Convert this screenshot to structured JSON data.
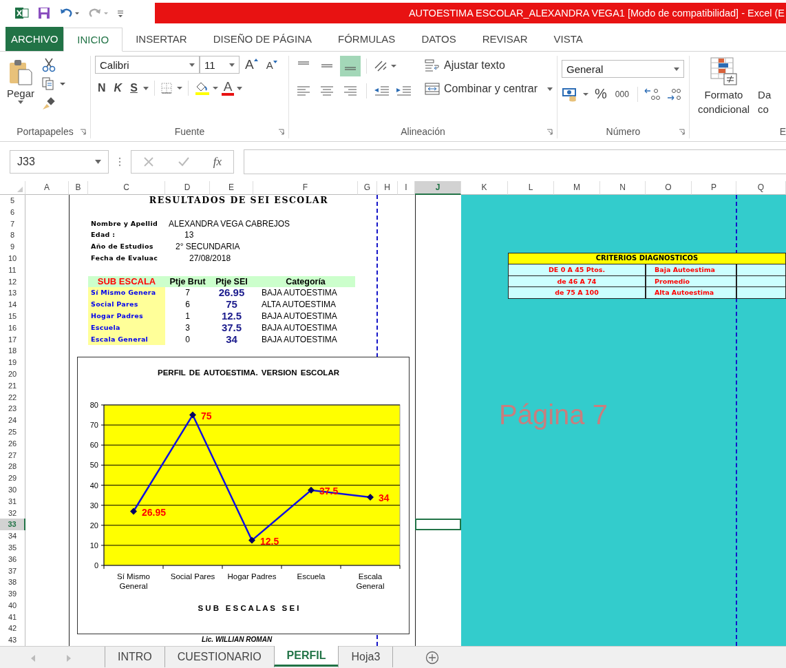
{
  "window": {
    "title": "AUTOESTIMA ESCOLAR_ALEXANDRA VEGA1  [Modo de compatibilidad] -  Excel (E"
  },
  "ribbon_tabs": [
    {
      "label": "ARCHIVO",
      "kind": "file",
      "selected": false
    },
    {
      "label": "INICIO",
      "kind": "tab",
      "selected": true
    },
    {
      "label": "INSERTAR",
      "kind": "tab",
      "selected": false
    },
    {
      "label": "DISEÑO DE PÁGINA",
      "kind": "tab",
      "selected": false
    },
    {
      "label": "FÓRMULAS",
      "kind": "tab",
      "selected": false
    },
    {
      "label": "DATOS",
      "kind": "tab",
      "selected": false
    },
    {
      "label": "REVISAR",
      "kind": "tab",
      "selected": false
    },
    {
      "label": "VISTA",
      "kind": "tab",
      "selected": false
    }
  ],
  "ribbon": {
    "clipboard": {
      "paste": "Pegar",
      "label": "Portapapeles"
    },
    "font": {
      "family": "Calibri",
      "size": "11",
      "grow": "A",
      "shrink": "A",
      "bold": "N",
      "italic": "K",
      "underline": "S",
      "font_color": "A",
      "label": "Fuente"
    },
    "alignment": {
      "vertical": [
        {
          "kind": "top",
          "selected": false
        },
        {
          "kind": "middle",
          "selected": false
        },
        {
          "kind": "bottom",
          "selected": true
        }
      ],
      "wrap": "Ajustar texto",
      "merge": "Combinar y centrar",
      "label": "Alineación"
    },
    "number": {
      "format": "General",
      "percent": "%",
      "thousands": "000",
      "label": "Número"
    },
    "styles": {
      "conditional": "Formato\ncondicional",
      "next": "Da\nco",
      "label": "E"
    }
  },
  "formula_bar": {
    "name_box": "J33",
    "function_label": "fx"
  },
  "columns": [
    {
      "label": "A",
      "selected": false
    },
    {
      "label": "B",
      "selected": false
    },
    {
      "label": "C",
      "selected": false
    },
    {
      "label": "D",
      "selected": false
    },
    {
      "label": "E",
      "selected": false
    },
    {
      "label": "F",
      "selected": false
    },
    {
      "label": "G",
      "selected": false
    },
    {
      "label": "H",
      "selected": false
    },
    {
      "label": "I",
      "selected": false
    },
    {
      "label": "J",
      "selected": true
    },
    {
      "label": "K",
      "selected": false
    },
    {
      "label": "L",
      "selected": false
    },
    {
      "label": "M",
      "selected": false
    },
    {
      "label": "N",
      "selected": false
    },
    {
      "label": "O",
      "selected": false
    },
    {
      "label": "P",
      "selected": false
    },
    {
      "label": "Q",
      "selected": false
    }
  ],
  "rows": [
    {
      "label": "5",
      "selected": false
    },
    {
      "label": "6",
      "selected": false
    },
    {
      "label": "7",
      "selected": false
    },
    {
      "label": "8",
      "selected": false
    },
    {
      "label": "9",
      "selected": false
    },
    {
      "label": "10",
      "selected": false
    },
    {
      "label": "11",
      "selected": false
    },
    {
      "label": "12",
      "selected": false
    },
    {
      "label": "13",
      "selected": false
    },
    {
      "label": "14",
      "selected": false
    },
    {
      "label": "15",
      "selected": false
    },
    {
      "label": "16",
      "selected": false
    },
    {
      "label": "17",
      "selected": false
    },
    {
      "label": "18",
      "selected": false
    },
    {
      "label": "19",
      "selected": false
    },
    {
      "label": "20",
      "selected": false
    },
    {
      "label": "21",
      "selected": false
    },
    {
      "label": "22",
      "selected": false
    },
    {
      "label": "23",
      "selected": false
    },
    {
      "label": "24",
      "selected": false
    },
    {
      "label": "25",
      "selected": false
    },
    {
      "label": "26",
      "selected": false
    },
    {
      "label": "27",
      "selected": false
    },
    {
      "label": "28",
      "selected": false
    },
    {
      "label": "29",
      "selected": false
    },
    {
      "label": "30",
      "selected": false
    },
    {
      "label": "31",
      "selected": false
    },
    {
      "label": "32",
      "selected": false
    },
    {
      "label": "33",
      "selected": true
    },
    {
      "label": "34",
      "selected": false
    },
    {
      "label": "35",
      "selected": false
    },
    {
      "label": "36",
      "selected": false
    },
    {
      "label": "37",
      "selected": false
    },
    {
      "label": "38",
      "selected": false
    },
    {
      "label": "39",
      "selected": false
    },
    {
      "label": "40",
      "selected": false
    },
    {
      "label": "41",
      "selected": false
    },
    {
      "label": "42",
      "selected": false
    },
    {
      "label": "43",
      "selected": false
    }
  ],
  "sheet": {
    "title": "RESULTADOS DE SEI ESCOLAR",
    "info": [
      {
        "label": "Nombre y Apellid",
        "value": "ALEXANDRA VEGA CABREJOS"
      },
      {
        "label": "Edad :",
        "value": "13"
      },
      {
        "label": "Año de Estudios",
        "value": "2° SECUNDARIA"
      },
      {
        "label": "Fecha de Evaluac",
        "value": "27/08/2018"
      }
    ],
    "table_columns": [
      "SUB ESCALA",
      "Ptje Brut",
      "Ptje SEI",
      "Categoría"
    ],
    "table_rows": [
      {
        "name": "Sí Mismo Genera",
        "raw": "7",
        "sei": "26.95",
        "category": "BAJA AUTOESTIMA"
      },
      {
        "name": "Social Pares",
        "raw": "6",
        "sei": "75",
        "category": "ALTA AUTOESTIMA"
      },
      {
        "name": "Hogar  Padres",
        "raw": "1",
        "sei": "12.5",
        "category": "BAJA AUTOESTIMA"
      },
      {
        "name": "Escuela",
        "raw": "3",
        "sei": "37.5",
        "category": "BAJA AUTOESTIMA"
      },
      {
        "name": "Escala General",
        "raw": "0",
        "sei": "34",
        "category": "BAJA AUTOESTIMA"
      }
    ],
    "chart_data": {
      "type": "line",
      "title": "PERFIL  DE  AUTOESTIMA. VERSION  ESCOLAR",
      "xlabel": "S U B   E S C A L A S   S E I",
      "categories": [
        "Sí Mismo\nGeneral",
        "Social Pares",
        "Hogar  Padres",
        "Escuela",
        "Escala\nGeneral"
      ],
      "series": [
        {
          "color": "#1010e0",
          "marker": "diamond",
          "values": [
            26.95,
            75,
            12.5,
            37.5,
            34
          ]
        }
      ],
      "ylim": [
        0,
        80
      ],
      "yticks": [
        0,
        10,
        20,
        30,
        40,
        50,
        60,
        70,
        80
      ],
      "grid": true,
      "data_labels": true
    },
    "signature": "Lic. WILLIAN ROMAN",
    "page_label": "Página 7",
    "criteria": {
      "title": "CRITERIOS DIAGNOSTICOS",
      "rows": [
        {
          "range": "DE 0 A 45 Ptos.",
          "result": "Baja Autoestima"
        },
        {
          "range": "de 46 A 74",
          "result": "Promedio"
        },
        {
          "range": "de 75 A 100",
          "result": "Alta Autoestima"
        }
      ]
    }
  },
  "sheet_tabs": [
    {
      "label": "INTRO",
      "selected": false
    },
    {
      "label": "CUESTIONARIO",
      "selected": false
    },
    {
      "label": "PERFIL",
      "selected": true
    },
    {
      "label": "Hoja3",
      "selected": false
    }
  ]
}
